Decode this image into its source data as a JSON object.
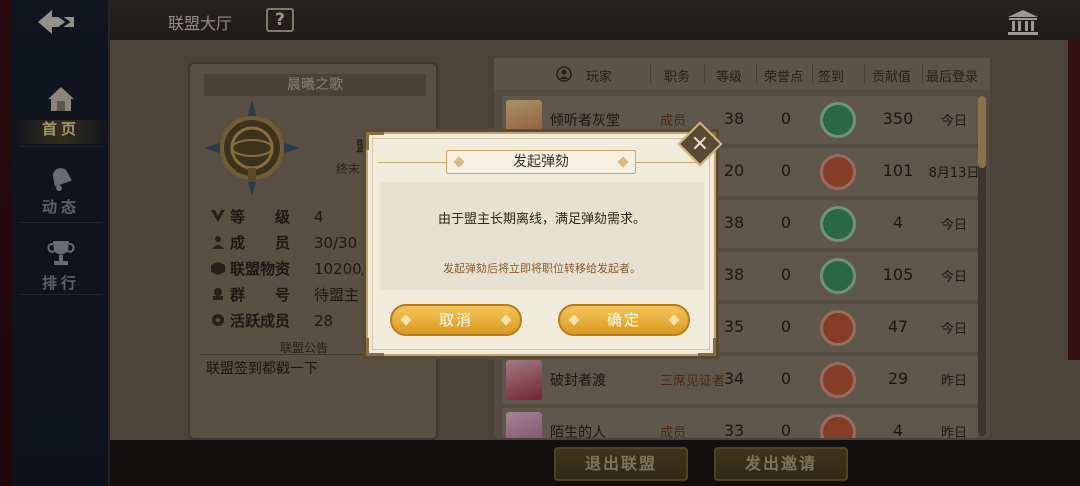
{
  "nav": {
    "items": [
      {
        "label": "首页"
      },
      {
        "label": "动态"
      },
      {
        "label": "排行"
      }
    ]
  },
  "topbar": {
    "title": "联盟大厅",
    "help_symbol": "?"
  },
  "alliance": {
    "name": "晨曦之歌",
    "leader_partial": "盟",
    "motto_partial": "终末",
    "info": [
      {
        "label": "等　　级",
        "value": "4"
      },
      {
        "label": "成　　员",
        "value": "30/30"
      },
      {
        "label": "联盟物资",
        "value": "10200/"
      },
      {
        "label": "群　　号",
        "value": "待盟主"
      },
      {
        "label": "活跃成员",
        "value": "28"
      }
    ],
    "notice_title": "联盟公告",
    "notice_text": "联盟签到都戳一下"
  },
  "members": {
    "headers": {
      "player": "玩家",
      "role": "职务",
      "level": "等级",
      "honor": "荣誉点",
      "signin": "签到",
      "contrib": "贡献值",
      "last_login": "最后登录"
    },
    "rows": [
      {
        "name": "倾听者灰堂",
        "role": "成员",
        "level": "38",
        "honor": "0",
        "signed": true,
        "contrib": "350",
        "login": "今日"
      },
      {
        "name": "",
        "role": "",
        "level": "20",
        "honor": "0",
        "signed": false,
        "contrib": "101",
        "login": "8月13日"
      },
      {
        "name": "",
        "role": "",
        "level": "38",
        "honor": "0",
        "signed": true,
        "contrib": "4",
        "login": "今日"
      },
      {
        "name": "",
        "role": "",
        "level": "38",
        "honor": "0",
        "signed": true,
        "contrib": "105",
        "login": "今日"
      },
      {
        "name": "",
        "role": "",
        "level": "35",
        "honor": "0",
        "signed": false,
        "contrib": "47",
        "login": "今日"
      },
      {
        "name": "破封者渡",
        "role": "三席见证者",
        "level": "34",
        "honor": "0",
        "signed": false,
        "contrib": "29",
        "login": "昨日"
      },
      {
        "name": "陌生的人",
        "role": "成员",
        "level": "33",
        "honor": "0",
        "signed": false,
        "contrib": "4",
        "login": "昨日"
      }
    ]
  },
  "actions": {
    "quit": "退出联盟",
    "invite": "发出邀请"
  },
  "dialog": {
    "title": "发起弹劾",
    "message": "由于盟主长期离线，满足弹劾需求。",
    "note": "发起弹劾后将立即将职位转移给发起者。",
    "cancel": "取消",
    "confirm": "确定"
  },
  "colors": {
    "gold_button": "#e0a52b",
    "signed_green": "#3f9a63",
    "unsigned_red": "#c65a3c"
  }
}
